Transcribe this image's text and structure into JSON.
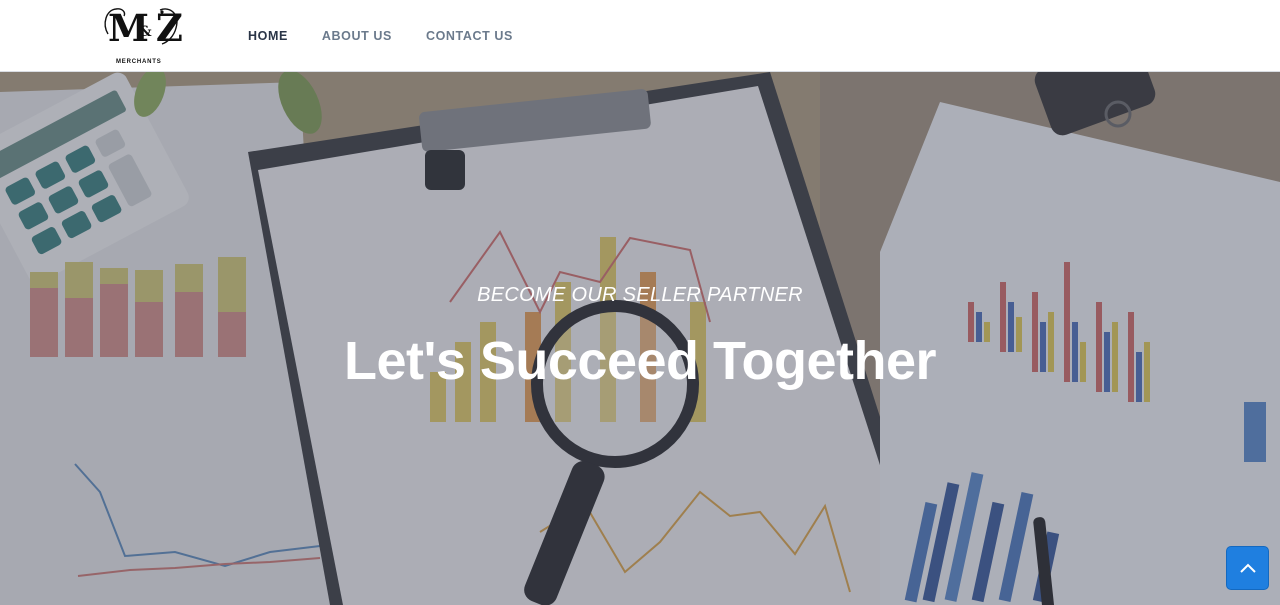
{
  "brand": {
    "logo_text": "M&Z",
    "logo_subtitle": "MERCHANTS"
  },
  "nav": {
    "items": [
      {
        "label": "HOME",
        "active": true
      },
      {
        "label": "ABOUT US",
        "active": false
      },
      {
        "label": "CONTACT US",
        "active": false
      }
    ]
  },
  "hero": {
    "subtitle": "BECOME OUR SELLER PARTNER",
    "title": "Let's Succeed Together"
  },
  "scroll_top": {
    "icon": "chevron-up-icon",
    "color": "#1f7fe0"
  }
}
